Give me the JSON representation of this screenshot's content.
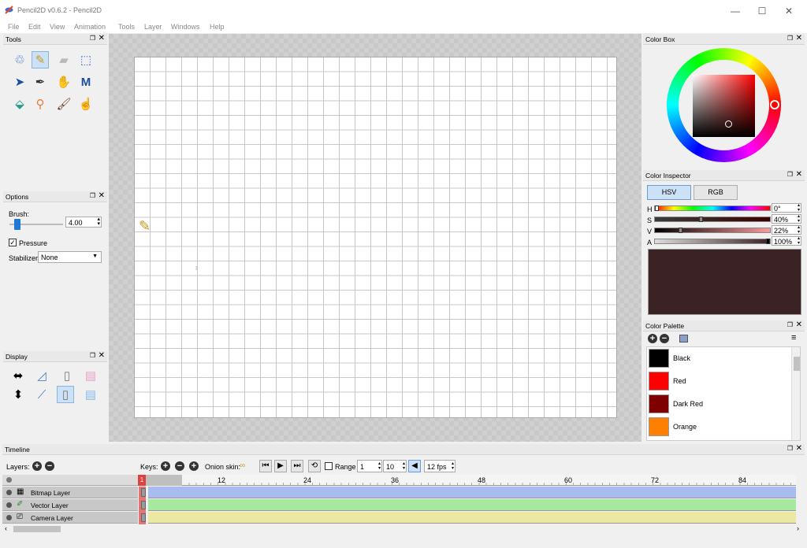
{
  "window": {
    "title": "Pencil2D v0.6.2 - Pencil2D",
    "min": "—",
    "max": "☐",
    "close": "✕"
  },
  "menu": [
    "File",
    "Edit",
    "View",
    "Animation",
    "Tools",
    "Layer",
    "Windows",
    "Help"
  ],
  "tools_panel": {
    "title": "Tools"
  },
  "options_panel": {
    "title": "Options",
    "brush_label": "Brush:",
    "brush_value": "4.00",
    "pressure_label": "Pressure",
    "pressure_checked": true,
    "stabilizer_label": "Stabilizer",
    "stabilizer_value": "None"
  },
  "display_panel": {
    "title": "Display"
  },
  "colorbox": {
    "title": "Color Box"
  },
  "inspector": {
    "title": "Color Inspector",
    "tab_hsv": "HSV",
    "tab_rgb": "RGB",
    "h_label": "H",
    "h_value": "0°",
    "s_label": "S",
    "s_value": "40%",
    "v_label": "V",
    "v_value": "22%",
    "a_label": "A",
    "a_value": "100%",
    "preview_color": "#3b2224"
  },
  "palette": {
    "title": "Color Palette",
    "colors": [
      {
        "name": "Black",
        "hex": "#000000"
      },
      {
        "name": "Red",
        "hex": "#ff0000"
      },
      {
        "name": "Dark Red",
        "hex": "#7f0000"
      },
      {
        "name": "Orange",
        "hex": "#ff8000"
      }
    ]
  },
  "timeline": {
    "title": "Timeline",
    "layers_label": "Layers:",
    "keys_label": "Keys:",
    "onion_label": "Onion skin:",
    "range_label": "Range",
    "range_start": "1",
    "range_end": "10",
    "fps": "12 fps",
    "frame_ticks": [
      "12",
      "24",
      "36",
      "48",
      "60",
      "72",
      "84"
    ],
    "current_frame": "1",
    "layers": [
      {
        "name": "Bitmap Layer",
        "color": "#a9bcf0"
      },
      {
        "name": "Vector Layer",
        "color": "#a6e8a0"
      },
      {
        "name": "Camera Layer",
        "color": "#ece7a2"
      }
    ]
  }
}
